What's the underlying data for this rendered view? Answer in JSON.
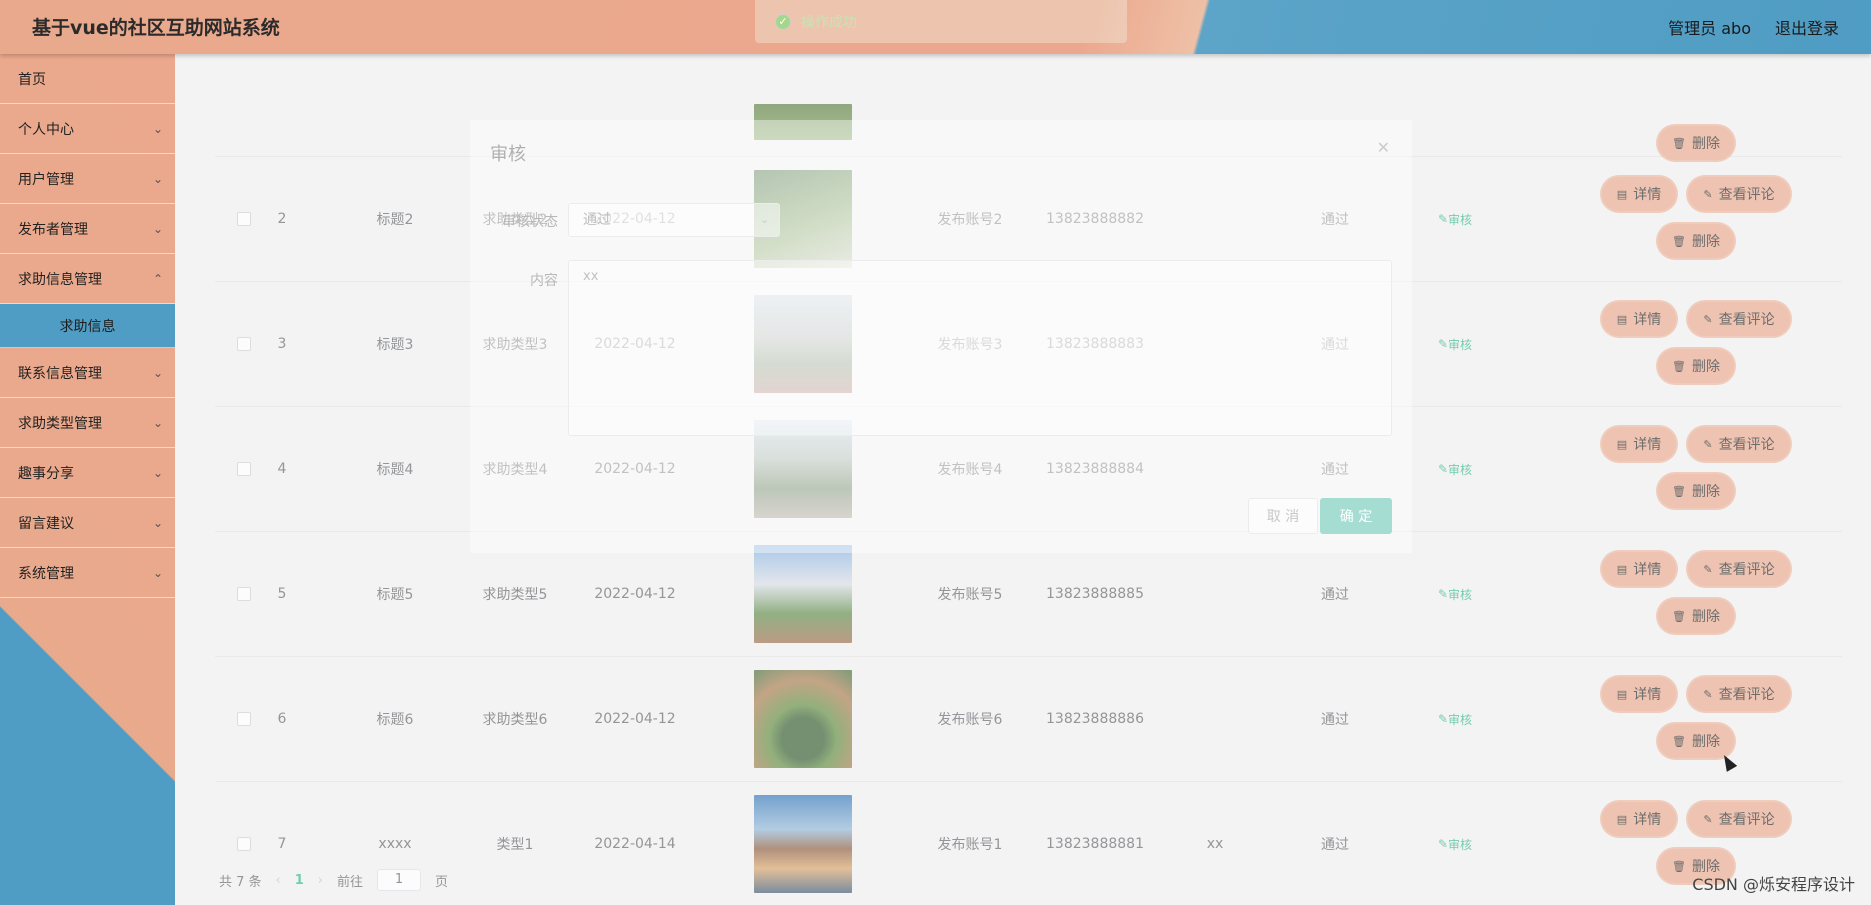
{
  "header": {
    "brand": "基于vue的社区互助网站系统",
    "user_label": "管理员 abo",
    "logout_label": "退出登录"
  },
  "toast": {
    "message": "操作成功",
    "icon": "check-circle-icon"
  },
  "sidebar": {
    "items": [
      {
        "label": "首页",
        "has_children": false
      },
      {
        "label": "个人中心",
        "has_children": true
      },
      {
        "label": "用户管理",
        "has_children": true
      },
      {
        "label": "发布者管理",
        "has_children": true
      },
      {
        "label": "求助信息管理",
        "has_children": true
      },
      {
        "label": "联系信息管理",
        "has_children": true
      },
      {
        "label": "求助类型管理",
        "has_children": true
      },
      {
        "label": "趣事分享",
        "has_children": true
      },
      {
        "label": "留言建议",
        "has_children": true
      },
      {
        "label": "系统管理",
        "has_children": true
      }
    ],
    "active_sub": "求助信息"
  },
  "table": {
    "rows": [
      {
        "idx": "2",
        "title": "标题2",
        "type": "求助类型2",
        "date": "2022-04-12",
        "account": "发布账号2",
        "phone": "13823888882",
        "content": "",
        "status": "通过"
      },
      {
        "idx": "3",
        "title": "标题3",
        "type": "求助类型3",
        "date": "2022-04-12",
        "account": "发布账号3",
        "phone": "13823888883",
        "content": "",
        "status": "通过"
      },
      {
        "idx": "4",
        "title": "标题4",
        "type": "求助类型4",
        "date": "2022-04-12",
        "account": "发布账号4",
        "phone": "13823888884",
        "content": "",
        "status": "通过"
      },
      {
        "idx": "5",
        "title": "标题5",
        "type": "求助类型5",
        "date": "2022-04-12",
        "account": "发布账号5",
        "phone": "13823888885",
        "content": "",
        "status": "通过"
      },
      {
        "idx": "6",
        "title": "标题6",
        "type": "求助类型6",
        "date": "2022-04-12",
        "account": "发布账号6",
        "phone": "13823888886",
        "content": "",
        "status": "通过"
      },
      {
        "idx": "7",
        "title": "xxxx",
        "type": "类型1",
        "date": "2022-04-14",
        "account": "发布账号1",
        "phone": "13823888881",
        "content": "xx",
        "status": "通过"
      }
    ],
    "audit_label": "审核",
    "detail_label": "详情",
    "comment_label": "查看评论",
    "delete_label": "删除"
  },
  "pager": {
    "total_label": "共 7 条",
    "current_page": "1",
    "goto_label": "前往",
    "goto_value": "1",
    "page_suffix": "页"
  },
  "dialog": {
    "title": "审核",
    "status_label": "审核状态",
    "status_value": "通过",
    "content_label": "内容",
    "content_value": "xx",
    "cancel_label": "取 消",
    "confirm_label": "确 定"
  },
  "watermark": "CSDN @烁安程序设计"
}
